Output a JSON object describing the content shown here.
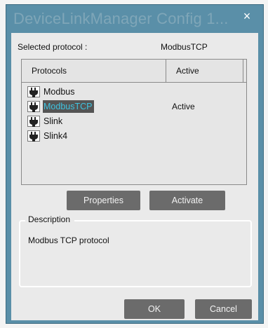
{
  "window": {
    "title": "DeviceLinkManager Config 1...",
    "close_glyph": "×"
  },
  "selected_protocol": {
    "label": "Selected protocol :",
    "value": "ModbusTCP"
  },
  "protocol_list": {
    "columns": [
      "Protocols",
      "Active"
    ],
    "rows": [
      {
        "name": "Modbus",
        "active": "",
        "icon": "plug-icon"
      },
      {
        "name": "ModbusTCP",
        "active": "Active",
        "icon": "plug-icon",
        "selected": true
      },
      {
        "name": "Slink",
        "active": "",
        "icon": "plug-icon"
      },
      {
        "name": "Slink4",
        "active": "",
        "icon": "plug-icon"
      }
    ]
  },
  "buttons": {
    "properties": "Properties",
    "activate": "Activate",
    "ok": "OK",
    "cancel": "Cancel"
  },
  "description": {
    "group_title": "Description",
    "text": "Modbus TCP protocol"
  },
  "colors": {
    "title_bar": "#5a8fa8",
    "selection_bg": "#545454",
    "selection_text": "#3fc3e0",
    "button_bg": "#6b6b6b"
  }
}
